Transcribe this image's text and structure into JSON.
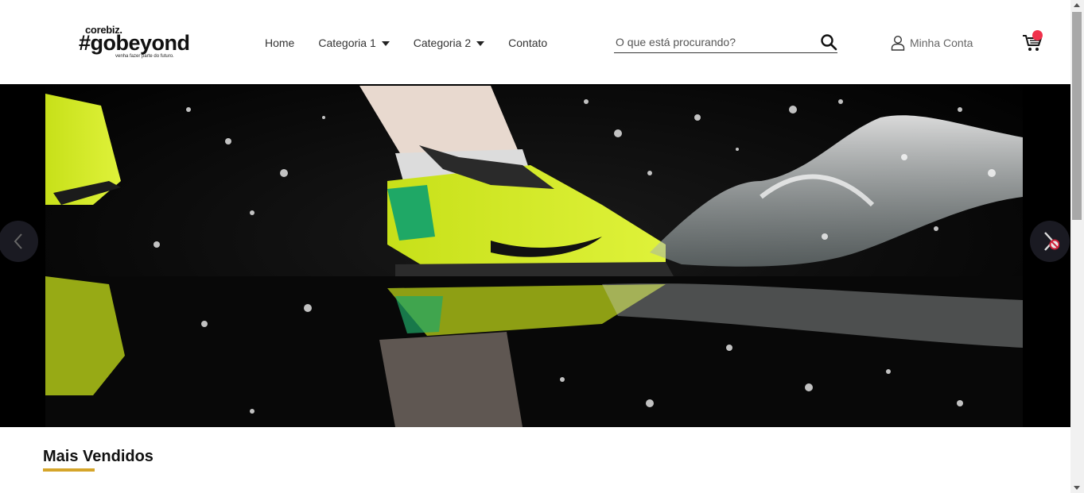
{
  "brand": {
    "top": "corebiz.",
    "main": "#gobeyond",
    "tagline": "venha fazer parte do futuro."
  },
  "nav": {
    "items": [
      {
        "label": "Home",
        "has_dropdown": false
      },
      {
        "label": "Categoria 1",
        "has_dropdown": true
      },
      {
        "label": "Categoria 2",
        "has_dropdown": true
      },
      {
        "label": "Contato",
        "has_dropdown": false
      }
    ]
  },
  "search": {
    "placeholder": "O que está procurando?",
    "value": ""
  },
  "account": {
    "label": "Minha Conta"
  },
  "cart": {
    "badge_color": "#f0314b"
  },
  "hero": {
    "icons": [
      "chevron-left-icon",
      "chevron-right-icon"
    ]
  },
  "section": {
    "title": "Mais Vendidos",
    "accent_color": "#d5a52a"
  }
}
